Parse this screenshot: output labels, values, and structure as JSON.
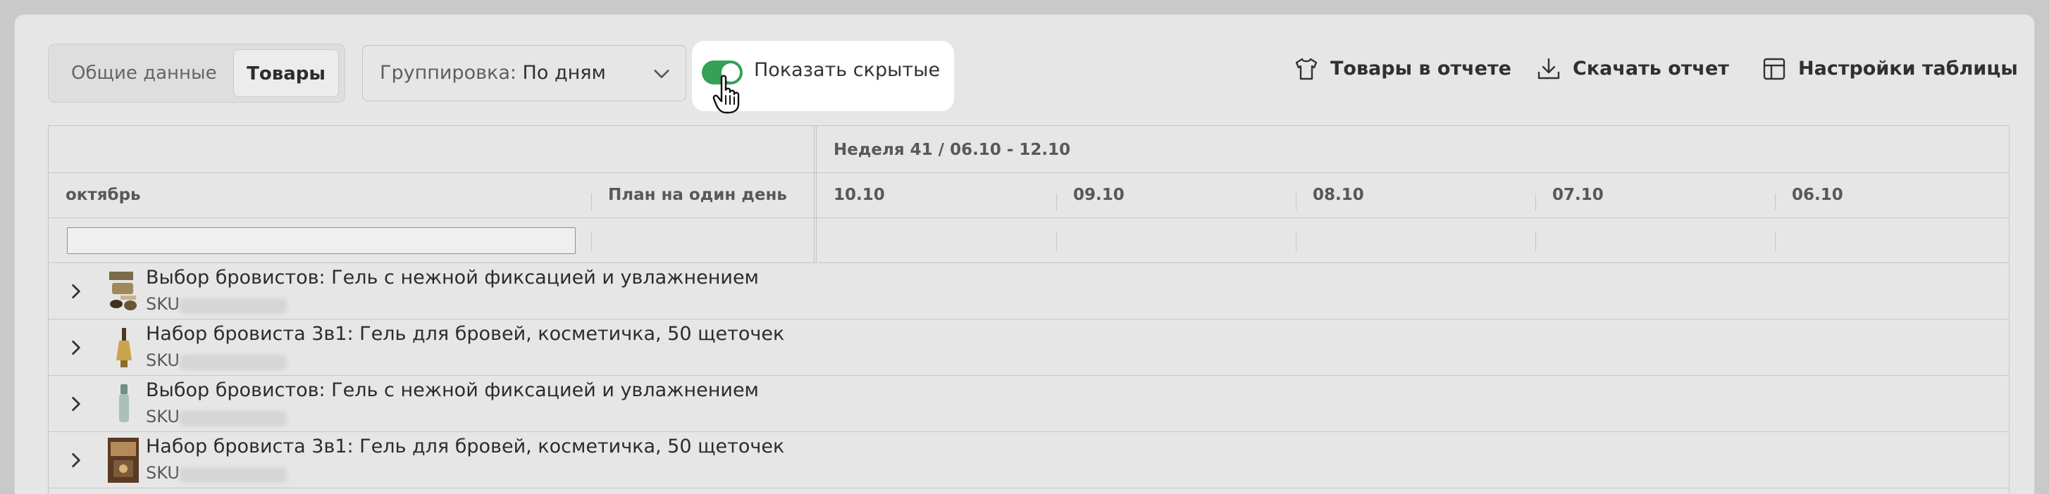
{
  "tabs": {
    "general_label": "Общие данные",
    "products_label": "Товары"
  },
  "grouping": {
    "prefix": "Группировка: ",
    "value": "По дням"
  },
  "toggle": {
    "label": "Показать скрытые",
    "state": "on",
    "color": "#34a058"
  },
  "actions": {
    "products_in_report": "Товары в отчете",
    "download_report": "Скачать отчет",
    "table_settings": "Настройки таблицы"
  },
  "table": {
    "week_label": "Неделя 41 / 06.10 - 12.10",
    "month_header": "октябрь",
    "plan_header": "План на один день",
    "filter_value": "",
    "date_columns": [
      "10.10",
      "09.10",
      "08.10",
      "07.10",
      "06.10"
    ],
    "rows": [
      {
        "name": "Выбор бровистов: Гель с нежной фиксацией и увлажнением",
        "sku_prefix": "SKU"
      },
      {
        "name": "Набор бровиста 3в1: Гель для бровей, косметичка, 50 щеточек",
        "sku_prefix": "SKU"
      },
      {
        "name": "Выбор бровистов: Гель с нежной фиксацией и увлажнением",
        "sku_prefix": "SKU"
      },
      {
        "name": "Набор бровиста 3в1: Гель для бровей, косметичка, 50 щеточек",
        "sku_prefix": "SKU"
      }
    ]
  }
}
